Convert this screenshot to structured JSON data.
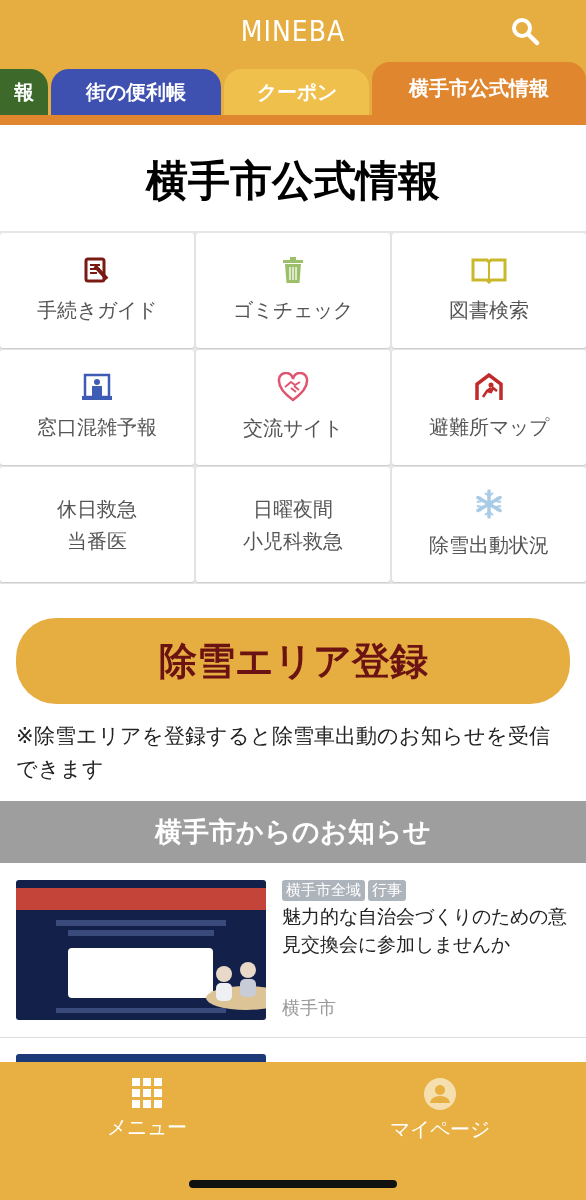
{
  "header": {
    "logo": "MINEBA"
  },
  "tabs": [
    {
      "label": "報",
      "color": "#3d6a2a",
      "selected": false
    },
    {
      "label": "街の便利帳",
      "color": "#3f51b0",
      "selected": false
    },
    {
      "label": "クーポン",
      "color": "#f0c04c",
      "selected": false
    },
    {
      "label": "横手市公式情報",
      "color": "#e0862e",
      "selected": true
    }
  ],
  "page_title": "横手市公式情報",
  "menu": [
    {
      "label": [
        "手続きガイド"
      ]
    },
    {
      "label": [
        "ゴミチェック"
      ]
    },
    {
      "label": [
        "図書検索"
      ]
    },
    {
      "label": [
        "窓口混雑予報"
      ]
    },
    {
      "label": [
        "交流サイト"
      ]
    },
    {
      "label": [
        "避難所マップ"
      ]
    },
    {
      "label": [
        "休日救急",
        "当番医"
      ]
    },
    {
      "label": [
        "日曜夜間",
        "小児科救急"
      ]
    },
    {
      "label": [
        "除雪出動状況"
      ]
    }
  ],
  "register_button": "除雪エリア登録",
  "register_note": "※除雪エリアを登録すると除雪車出動のお知らせを受信できます",
  "news": {
    "title": "横手市からのお知らせ",
    "items": [
      {
        "tags": [
          "横手市全域",
          "行事"
        ],
        "title": "魅力的な自治会づくりのための意見交換会に参加しませんか",
        "source": "横手市"
      }
    ]
  },
  "bottom_nav": [
    {
      "label": "メニュー"
    },
    {
      "label": "マイページ"
    }
  ]
}
